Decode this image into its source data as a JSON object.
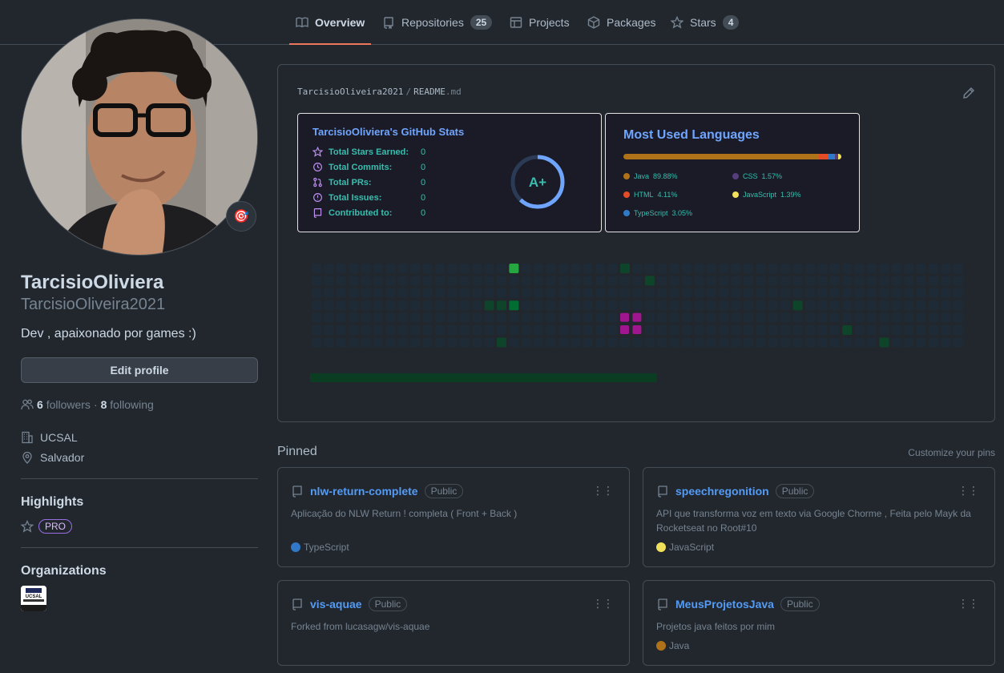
{
  "nav": {
    "tabs": [
      {
        "label": "Overview",
        "icon": "book-icon"
      },
      {
        "label": "Repositories",
        "count": "25",
        "icon": "repo-icon"
      },
      {
        "label": "Projects",
        "icon": "table-icon"
      },
      {
        "label": "Packages",
        "icon": "package-icon"
      },
      {
        "label": "Stars",
        "count": "4",
        "icon": "star-icon"
      }
    ]
  },
  "profile": {
    "fullname": "TarcisioOliviera",
    "username": "TarcisioOliveira2021",
    "bio": "Dev , apaixonado por games :)",
    "status_emoji": "🎯",
    "edit_label": "Edit profile",
    "followers_count": "6",
    "followers_label": "followers",
    "sep": "·",
    "following_count": "8",
    "following_label": "following",
    "company": "UCSAL",
    "location": "Salvador",
    "highlights_title": "Highlights",
    "pro_label": "PRO",
    "organizations_title": "Organizations",
    "org_logo_text": "UCSAL"
  },
  "readme": {
    "owner": "TarcisioOliveira2021",
    "slash": "/",
    "file": "README",
    "ext": ".md",
    "stats": {
      "title": "TarcisioOliviera's GitHub Stats",
      "rows": [
        {
          "label": "Total Stars Earned:",
          "value": "0",
          "icon": "star-icon"
        },
        {
          "label": "Total Commits:",
          "value": "0",
          "icon": "history-icon"
        },
        {
          "label": "Total PRs:",
          "value": "0",
          "icon": "pull-request-icon"
        },
        {
          "label": "Total Issues:",
          "value": "0",
          "icon": "issue-icon"
        },
        {
          "label": "Contributed to:",
          "value": "0",
          "icon": "repo-icon"
        }
      ],
      "grade": "A+",
      "grade_ring_fraction": 0.62
    },
    "languages": {
      "title": "Most Used Languages",
      "items": [
        {
          "name": "Java",
          "percent": "89.88%",
          "color": "#b07219"
        },
        {
          "name": "HTML",
          "percent": "4.11%",
          "color": "#e34c26"
        },
        {
          "name": "TypeScript",
          "percent": "3.05%",
          "color": "#3178c6"
        },
        {
          "name": "CSS",
          "percent": "1.57%",
          "color": "#563d7c"
        },
        {
          "name": "JavaScript",
          "percent": "1.39%",
          "color": "#f1e05a"
        }
      ],
      "shares": [
        89.88,
        4.11,
        3.05,
        1.57,
        1.39
      ]
    },
    "snake": {
      "columns": 53,
      "rows": 7,
      "highlights": [
        {
          "col": 16,
          "row": 0,
          "level": 3
        },
        {
          "col": 25,
          "row": 0,
          "level": 1
        },
        {
          "col": 27,
          "row": 1,
          "level": 1
        },
        {
          "col": 14,
          "row": 3,
          "level": 1
        },
        {
          "col": 15,
          "row": 3,
          "level": 1
        },
        {
          "col": 16,
          "row": 3,
          "level": 2
        },
        {
          "col": 39,
          "row": 3,
          "level": 1
        },
        {
          "col": 43,
          "row": 5,
          "level": 1
        },
        {
          "col": 15,
          "row": 6,
          "level": 1
        },
        {
          "col": 46,
          "row": 6,
          "level": 1
        }
      ],
      "snake_cells": [
        {
          "col": 25,
          "row": 4
        },
        {
          "col": 25,
          "row": 5
        },
        {
          "col": 26,
          "row": 4
        },
        {
          "col": 26,
          "row": 5
        }
      ],
      "progress": 0.53
    }
  },
  "pinned": {
    "title": "Pinned",
    "customize": "Customize your pins",
    "items": [
      {
        "name": "nlw-return-complete",
        "visibility": "Public",
        "desc": "Aplicação do NLW Return ! completa ( Front + Back )",
        "lang": "TypeScript",
        "lang_color": "#3178c6"
      },
      {
        "name": "speechregonition",
        "visibility": "Public",
        "desc": "API que transforma voz em texto via Google Chorme , Feita pelo Mayk da Rocketseat no Root#10",
        "lang": "JavaScript",
        "lang_color": "#f1e05a"
      },
      {
        "name": "vis-aquae",
        "visibility": "Public",
        "desc": "Forked from lucasagw/vis-aquae",
        "lang": "",
        "lang_color": ""
      },
      {
        "name": "MeusProjetosJava",
        "visibility": "Public",
        "desc": "Projetos java feitos por mim",
        "lang": "Java",
        "lang_color": "#b07219"
      }
    ]
  }
}
